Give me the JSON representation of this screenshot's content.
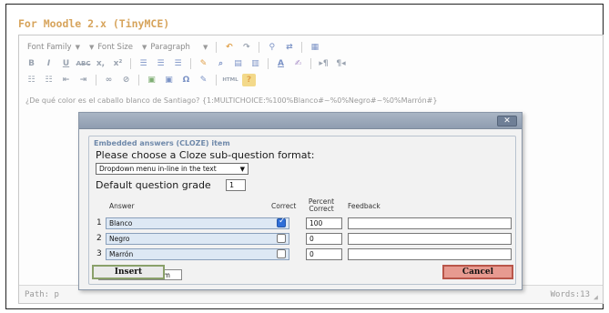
{
  "header": {
    "title": "For Moodle 2.x (TinyMCE)"
  },
  "toolbar": {
    "row1": {
      "font_family": "Font Family",
      "font_size": "Font Size",
      "format": "Paragraph",
      "buttons": [
        "undo-icon",
        "redo-icon",
        "find-icon",
        "replace-icon",
        "table-icon"
      ]
    },
    "row2": {
      "bold": "B",
      "italic": "I",
      "underline": "U",
      "strike": "ABC",
      "subscript": "x,",
      "superscript": "x²",
      "text_color": "A",
      "more": "▸¶",
      "more2": "¶◂"
    },
    "row3": {
      "html": "HTML",
      "help": "?"
    }
  },
  "content": {
    "text": "¿De qué color es el caballo blanco de Santiago? {1:MULTICHOICE:%100%Blanco#~%0%Negro#~%0%Marrón#}"
  },
  "dialog": {
    "close_label": "✕",
    "legend": "Embedded answers (CLOZE) item",
    "choose_label": "Please choose a Cloze sub-question format:",
    "format_value": "Dropdown menu in-line in the text",
    "grade_label": "Default question grade",
    "grade_value": "1",
    "columns": {
      "answer": "Answer",
      "correct": "Correct",
      "percent": "Percent Correct",
      "feedback": "Feedback"
    },
    "rows": [
      {
        "num": "1",
        "answer": "Blanco",
        "correct": true,
        "percent": "100",
        "feedback": ""
      },
      {
        "num": "2",
        "answer": "Negro",
        "correct": false,
        "percent": "0",
        "feedback": ""
      },
      {
        "num": "3",
        "answer": "Marrón",
        "correct": false,
        "percent": "0",
        "feedback": ""
      }
    ],
    "add_button": "Add 1 fields to form",
    "insert_button": "Insert",
    "cancel_button": "Cancel"
  },
  "statusbar": {
    "path": "Path: p",
    "words": "Words:13"
  }
}
